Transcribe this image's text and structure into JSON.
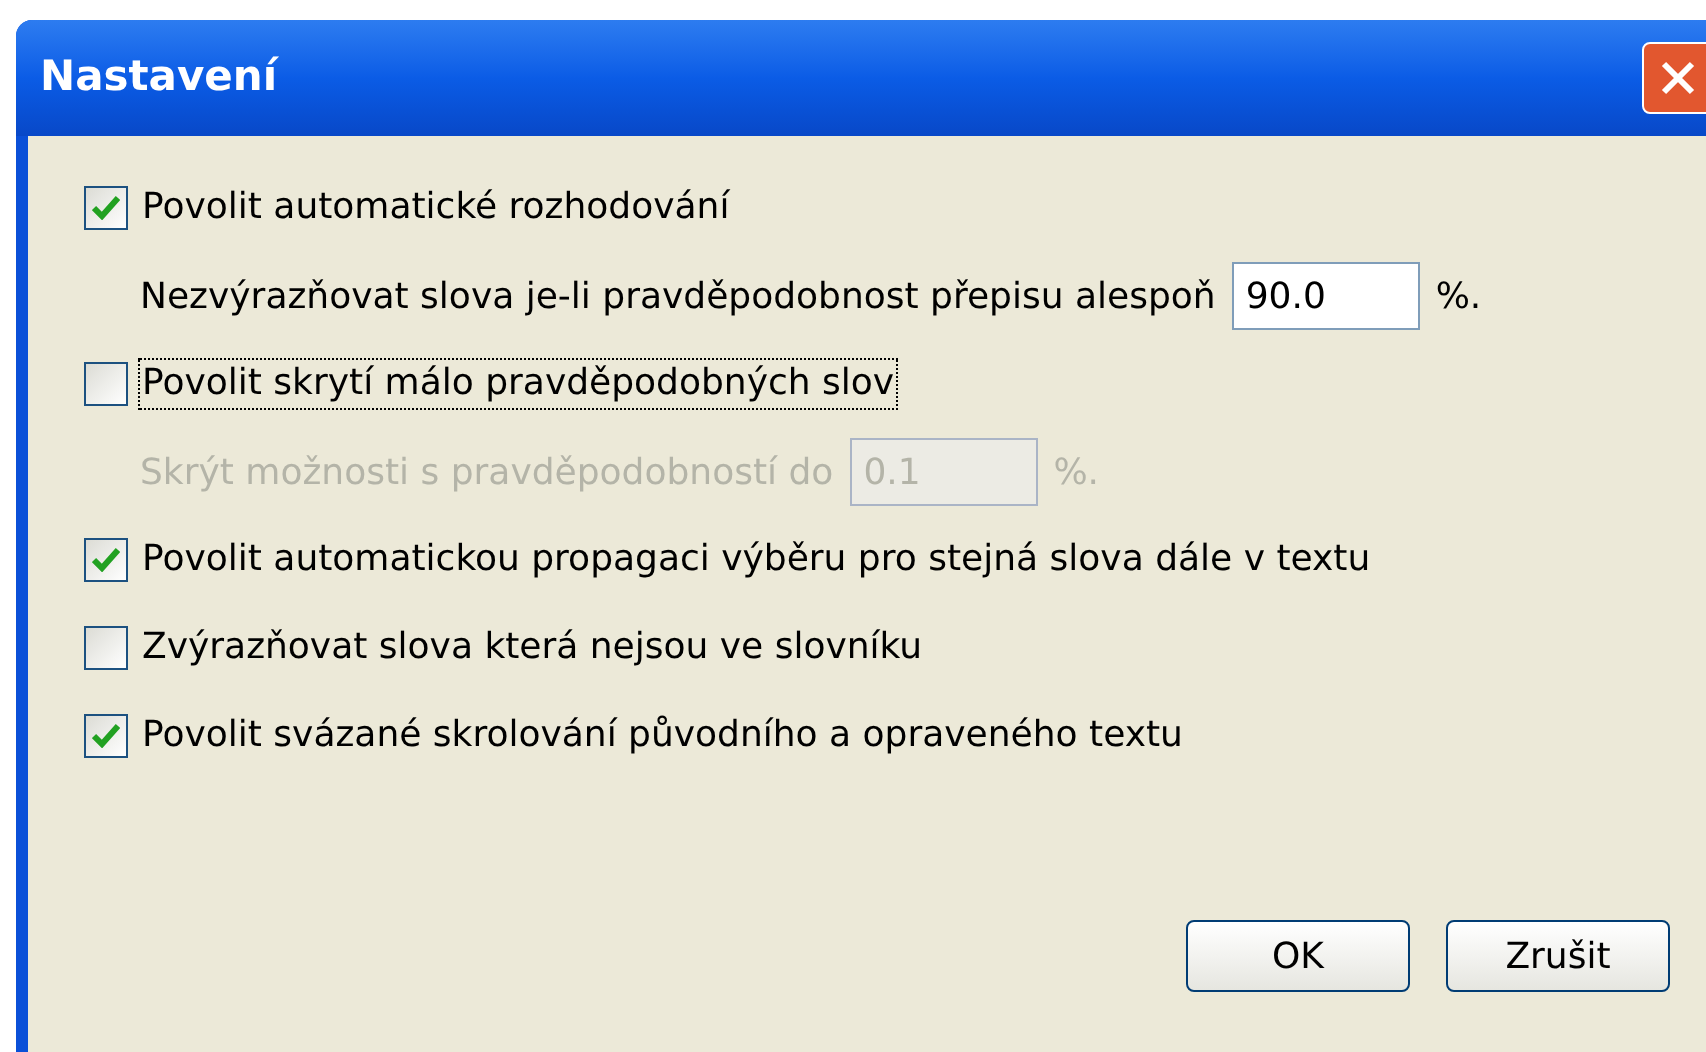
{
  "window": {
    "title": "Nastavení"
  },
  "options": [
    {
      "kind": "checkbox",
      "label": "Povolit automatické rozhodování",
      "checked": true,
      "focused": false
    },
    {
      "kind": "field",
      "label": "Nezvýrazňovat slova je-li pravděpodobnost přepisu alespoň",
      "value": "90.0",
      "suffix": "%.",
      "disabled": false
    },
    {
      "kind": "checkbox",
      "label": "Povolit skrytí málo pravděpodobných slov",
      "checked": false,
      "focused": true
    },
    {
      "kind": "field",
      "label": "Skrýt možnosti s pravděpodobností do",
      "value": "0.1",
      "suffix": "%.",
      "disabled": true
    },
    {
      "kind": "checkbox",
      "label": "Povolit automatickou propagaci výběru pro stejná slova dále v textu",
      "checked": true,
      "focused": false
    },
    {
      "kind": "checkbox",
      "label": "Zvýrazňovat slova která nejsou ve slovníku",
      "checked": false,
      "focused": false
    },
    {
      "kind": "checkbox",
      "label": "Povolit svázané skrolování původního a opraveného textu",
      "checked": true,
      "focused": false
    }
  ],
  "buttons": [
    "OK",
    "Zrušit"
  ]
}
